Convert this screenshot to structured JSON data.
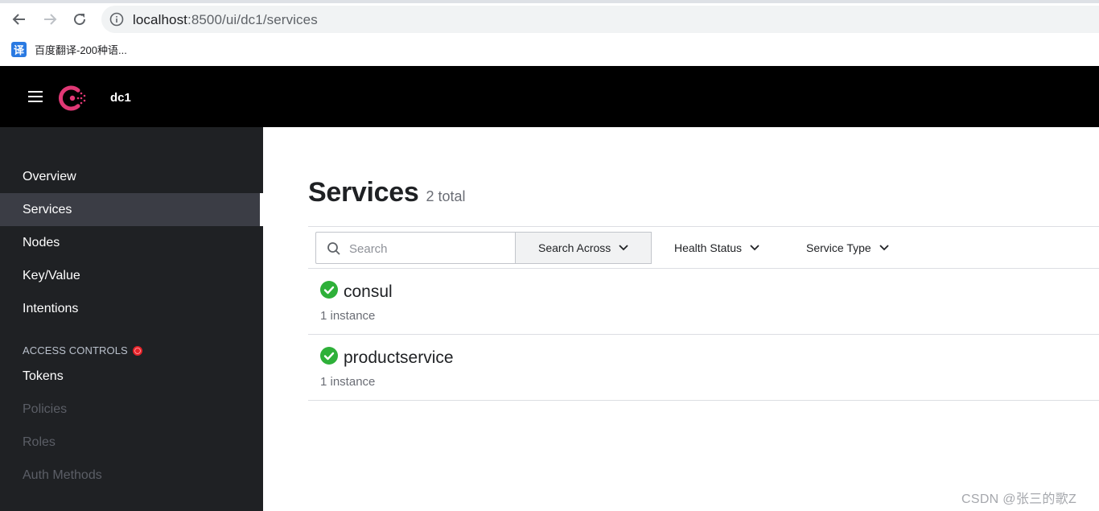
{
  "browser": {
    "url_host": "localhost",
    "url_rest": ":8500/ui/dc1/services",
    "bookmark_icon_char": "译",
    "bookmark_label": "百度翻译-200种语..."
  },
  "header": {
    "menu_icon": "hamburger-icon",
    "logo_icon": "consul-logo",
    "datacenter": "dc1",
    "brand_color": "#e03875"
  },
  "sidebar": {
    "items": [
      {
        "label": "Overview",
        "state": "normal"
      },
      {
        "label": "Services",
        "state": "active"
      },
      {
        "label": "Nodes",
        "state": "normal"
      },
      {
        "label": "Key/Value",
        "state": "normal"
      },
      {
        "label": "Intentions",
        "state": "normal"
      }
    ],
    "section_label": "ACCESS CONTROLS",
    "acl_items": [
      {
        "label": "Tokens",
        "state": "normal"
      },
      {
        "label": "Policies",
        "state": "disabled"
      },
      {
        "label": "Roles",
        "state": "disabled"
      },
      {
        "label": "Auth Methods",
        "state": "disabled"
      }
    ]
  },
  "main": {
    "title": "Services",
    "total": "2 total",
    "search_placeholder": "Search",
    "search_across_label": "Search Across",
    "health_status_label": "Health Status",
    "service_type_label": "Service Type",
    "services": [
      {
        "name": "consul",
        "instances": "1 instance",
        "health": "passing"
      },
      {
        "name": "productservice",
        "instances": "1 instance",
        "health": "passing"
      }
    ],
    "health_color": "#2eb039"
  },
  "watermark": "CSDN @张三的歌Z"
}
